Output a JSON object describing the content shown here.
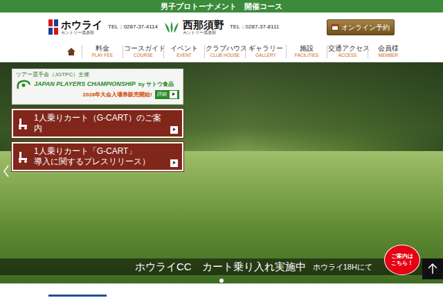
{
  "top_bar": {
    "title": "男子プロトーナメント　開催コース"
  },
  "header": {
    "clubs": [
      {
        "kind": "hourai",
        "name": "ホウライ",
        "sub": "カントリー倶楽部",
        "tel": "TEL：0287-37-4114"
      },
      {
        "kind": "nishinasuno",
        "name": "西那須野",
        "sub": "カントリー倶楽部",
        "tel": "TEL：0287-37-8111"
      }
    ],
    "booking_button": "オンライン予約"
  },
  "nav": {
    "items": [
      {
        "label": "料金",
        "en": "PLAY FEE"
      },
      {
        "label": "コースガイド",
        "en": "COURSE"
      },
      {
        "label": "イベント",
        "en": "EVENT"
      },
      {
        "label": "クラブハウス",
        "en": "CLUB HOUSE"
      },
      {
        "label": "ギャラリー",
        "en": "GALLERY"
      },
      {
        "label": "施設",
        "en": "FACILITIES"
      },
      {
        "label": "交通アクセス",
        "en": "ACCESS"
      },
      {
        "label": "会員様",
        "en": "MEMBER"
      }
    ]
  },
  "hero": {
    "banners": [
      {
        "kind": "tournament",
        "lines": [
          "ツアー選手会（JGTPC）主催",
          "JAPAN PLAYERS CHAMPIONSHIP",
          "by サトウ食品",
          "2026年大会入場券販売開始!"
        ],
        "button": "詳細",
        "arrow": "▶"
      },
      {
        "kind": "link",
        "lines": [
          "1人乗りカート（G-CART）のご案内"
        ],
        "arrow": "▶"
      },
      {
        "kind": "link",
        "lines": [
          "1人乗りカート「G-CART」",
          "導入に関するプレスリリース）"
        ],
        "arrow": "▶"
      }
    ],
    "caption": {
      "main": "ホウライCC　カート乗り入れ実施中",
      "sub": "ホウライ18Hにて"
    },
    "badge": "ご案内は\nこちら！",
    "dots": [
      {
        "selected": true
      }
    ]
  }
}
